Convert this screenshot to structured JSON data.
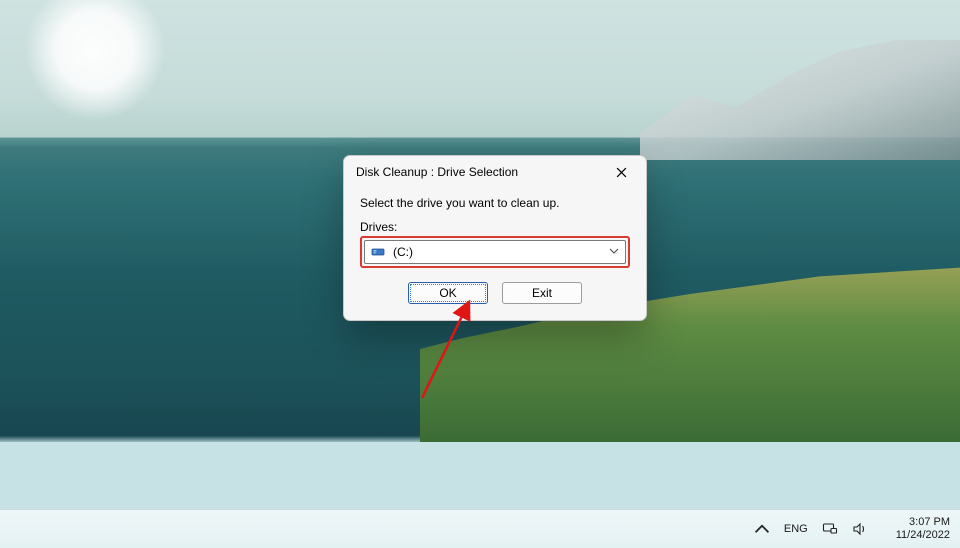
{
  "dialog": {
    "title": "Disk Cleanup : Drive Selection",
    "instruction": "Select the drive you want to clean up.",
    "drives_label": "Drives:",
    "selected_drive": " (C:)",
    "ok_label": "OK",
    "exit_label": "Exit"
  },
  "taskbar": {
    "lang": "ENG",
    "time": "3:07 PM",
    "date": "11/24/2022"
  },
  "icons": {
    "close": "close-icon",
    "drive": "drive-icon",
    "chevron_down": "chevron-down-icon",
    "chevron_up": "chevron-up-icon",
    "device": "device-icon",
    "volume": "volume-icon"
  },
  "annotation": {
    "arrow_target": "ok-button",
    "highlight_target": "drive-dropdown"
  }
}
